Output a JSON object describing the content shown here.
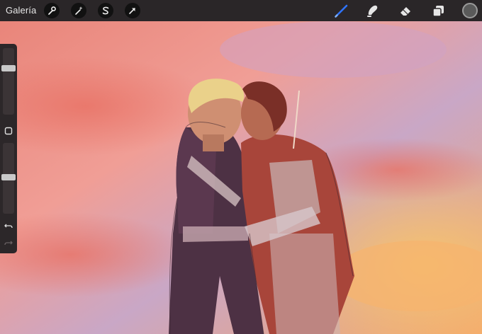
{
  "toolbar": {
    "gallery_label": "Galería",
    "left_tools": [
      "wrench-icon",
      "magic-wand-icon",
      "selection-s-icon",
      "transform-arrow-icon"
    ],
    "right_tools": [
      "brush-icon",
      "smudge-icon",
      "eraser-icon",
      "layers-icon"
    ],
    "active_tool": "brush-icon",
    "accent_color": "#2f74ff",
    "current_color": "#5a5a5a"
  },
  "sidebar": {
    "brush_size_level": 0.72,
    "opacity_level": 0.52,
    "buttons": [
      "modify-square-icon",
      "undo-icon",
      "redo-icon"
    ]
  },
  "canvas": {
    "sky_colors": [
      "#e9857a",
      "#f0a39a",
      "#c9a7c6",
      "#f4b06a"
    ]
  }
}
